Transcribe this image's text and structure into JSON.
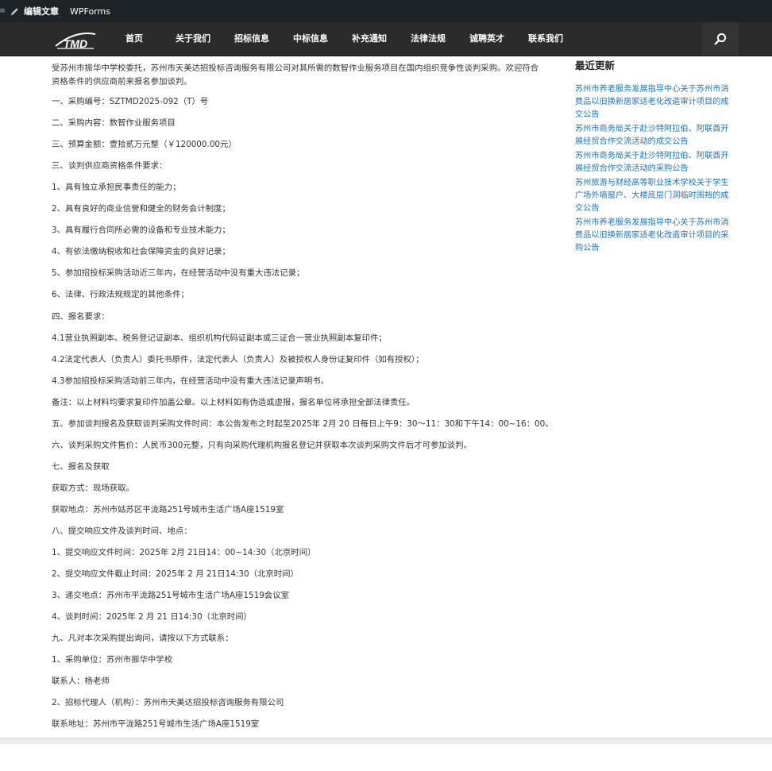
{
  "adminbar": {
    "edge_glyph": "≡",
    "edit_label": "编辑文章",
    "wpforms_label": "WPForms"
  },
  "nav": {
    "logo_text": "TMD",
    "items": [
      {
        "label": "首页"
      },
      {
        "label": "关于我们"
      },
      {
        "label": "招标信息"
      },
      {
        "label": "中标信息"
      },
      {
        "label": "补充通知"
      },
      {
        "label": "法律法规"
      },
      {
        "label": "诚聘英才"
      },
      {
        "label": "联系我们"
      }
    ]
  },
  "article": {
    "intro": "受苏州市振华中学校委托，苏州市天美达招投标咨询服务有限公司对其所需的数智作业服务项目在国内组织竞争性谈判采购。欢迎符合资格条件的供应商前来报名参加谈判。",
    "paragraphs": [
      "一、采购编号：SZTMD2025-092（T）号",
      "二、采购内容：数智作业服务项目",
      "三、预算金额：壹拾贰万元整（￥120000.00元）",
      "三、谈判供应商资格条件要求：",
      "1、具有独立承担民事责任的能力；",
      "2、具有良好的商业信誉和健全的财务会计制度；",
      "3、具有履行合同所必需的设备和专业技术能力；",
      "4、有依法缴纳税收和社会保障资金的良好记录；",
      "5、参加招投标采购活动近三年内，在经营活动中没有重大违法记录；",
      "6、法律、行政法规规定的其他条件；",
      "四、报名要求：",
      "4.1营业执照副本、税务登记证副本、组织机构代码证副本或三证合一营业执照副本复印件；",
      "4.2法定代表人（负责人）委托书原件，法定代表人（负责人）及被授权人身份证复印件（如有授权）；",
      "4.3参加招投标采购活动前三年内，在经营活动中没有重大违法记录声明书。",
      "备注：以上材料均要求复印件加盖公章。以上材料如有伪造或虚报，报名单位将承担全部法律责任。",
      "五、参加谈判报名及获取谈判采购文件时间：本公告发布之时起至2025年 2月 20 日每日上午9：30～11：30和下午14：00~16：00。",
      "六、谈判采购文件售价：人民币300元整，只有向采购代理机构报名登记并获取本次谈判采购文件后才可参加谈判。",
      "七、报名及获取",
      "获取方式：现场获取。",
      "获取地点：苏州市姑苏区平泷路251号城市生活广场A座1519室",
      "八、提交响应文件及谈判时间、地点：",
      "1、提交响应文件时间：2025年 2月 21日14：00~14:30（北京时间）",
      "2、提交响应文件截止时间：2025年 2 月  21日14:30（北京时间）",
      "3、递交地点：苏州市平泷路251号城市生活广场A座1519会议室",
      "4、谈判时间：2025年 2 月 21 日14:30（北京时间）",
      "九、凡对本次采购提出询问，请按以下方式联系：",
      "1、采购单位：苏州市振华中学校",
      "联系人：杨老师",
      "2、招标代理人（机构）：苏州市天美达招投标咨询服务有限公司",
      "联系地址：苏州市平泷路251号城市生活广场A座1519室"
    ]
  },
  "sidebar": {
    "title": "最近更新",
    "links": [
      {
        "lines": [
          "苏州市养老服务发展指导中心关于苏州市消",
          "费品以旧换新居家适老化改造审计项目的成",
          "交公告"
        ]
      },
      {
        "lines": [
          "苏州市商务局关于赴沙特阿拉伯、阿联酋开",
          "展经贸合作交流活动的成交公告"
        ]
      },
      {
        "lines": [
          "苏州市商务局关于赴沙特阿拉伯、阿联酋开",
          "展经贸合作交流活动的采购公告"
        ]
      },
      {
        "lines": [
          "苏州旅游与财经高等职业技术学校关于学生",
          "广场外墙窗户、大楼底层门洞临时围挡的成",
          "交公告"
        ]
      },
      {
        "lines": [
          "苏州市养老服务发展指导中心关于苏州市消",
          "费品以旧换新居家适老化改造审计项目的采",
          "购公告"
        ]
      }
    ]
  },
  "colors": {
    "adminbar_bg": "#1d2327",
    "nav_bg": "#2b2b2b",
    "link": "#1a75bb",
    "text": "#333333"
  }
}
